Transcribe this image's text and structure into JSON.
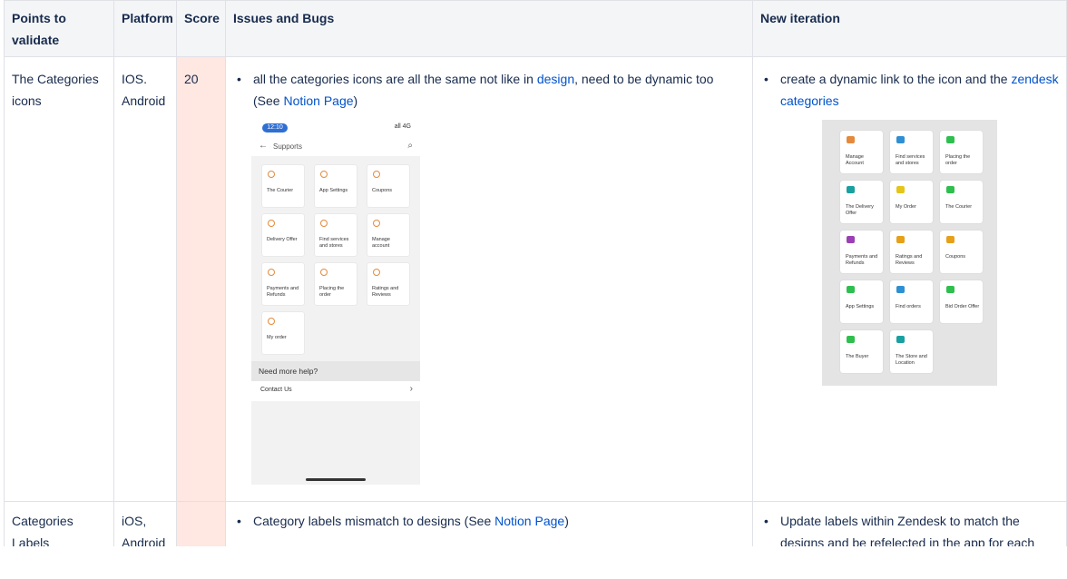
{
  "table": {
    "headers": {
      "points": "Points to validate",
      "platform": "Platform",
      "score": "Score",
      "issues": "Issues and Bugs",
      "iteration": "New iteration"
    },
    "rows": [
      {
        "point": "The Categories icons",
        "platform": "IOS. Android",
        "score": "20",
        "issue_pre": "all the categories icons are all the same not like in ",
        "issue_link1": "design",
        "issue_mid": ", need to be dynamic too (See ",
        "issue_link2": "Notion Page",
        "issue_post": ")",
        "iter_pre": "create a dynamic link to the icon and the ",
        "iter_link": "zendesk categories"
      },
      {
        "point": "Categories Labels",
        "platform": "iOS, Android",
        "score": "",
        "issue_pre": "Category labels mismatch to designs (See ",
        "issue_link": "Notion Page",
        "issue_post": ")",
        "iteration": "Update labels within Zendesk to match the designs and be refelected in the app for each user"
      }
    ]
  },
  "phone_mock": {
    "time": "12:10",
    "signal": "all 4G",
    "title": "Supports",
    "tiles": [
      "The Courier",
      "App Settings",
      "Coupons",
      "Delivery Offer",
      "Find services and stores",
      "Manage account",
      "Payments and Refunds",
      "Placing the order",
      "Ratings and Reviews",
      "My order"
    ],
    "help": "Need more help?",
    "contact": "Contact Us"
  },
  "grid_mock": {
    "tiles": [
      {
        "label": "Manage Account",
        "color": "#e58a3d"
      },
      {
        "label": "Find services and stores",
        "color": "#2f8fd3"
      },
      {
        "label": "Placing the order",
        "color": "#2fbf4f"
      },
      {
        "label": "The Delivery Offer",
        "color": "#1aa0a0"
      },
      {
        "label": "My Order",
        "color": "#e6c51a"
      },
      {
        "label": "The Courier",
        "color": "#2fbf4f"
      },
      {
        "label": "Payments and Refunds",
        "color": "#9b3fb5"
      },
      {
        "label": "Ratings and Reviews",
        "color": "#e6a01a"
      },
      {
        "label": "Coupons",
        "color": "#e6a01a"
      },
      {
        "label": "App Settings",
        "color": "#2fbf4f"
      },
      {
        "label": "Find orders",
        "color": "#2f8fd3"
      },
      {
        "label": "Bid Order Offer",
        "color": "#2fbf4f"
      },
      {
        "label": "The Buyer",
        "color": "#2fbf4f"
      },
      {
        "label": "The Store and Location",
        "color": "#1aa0a0"
      }
    ]
  }
}
